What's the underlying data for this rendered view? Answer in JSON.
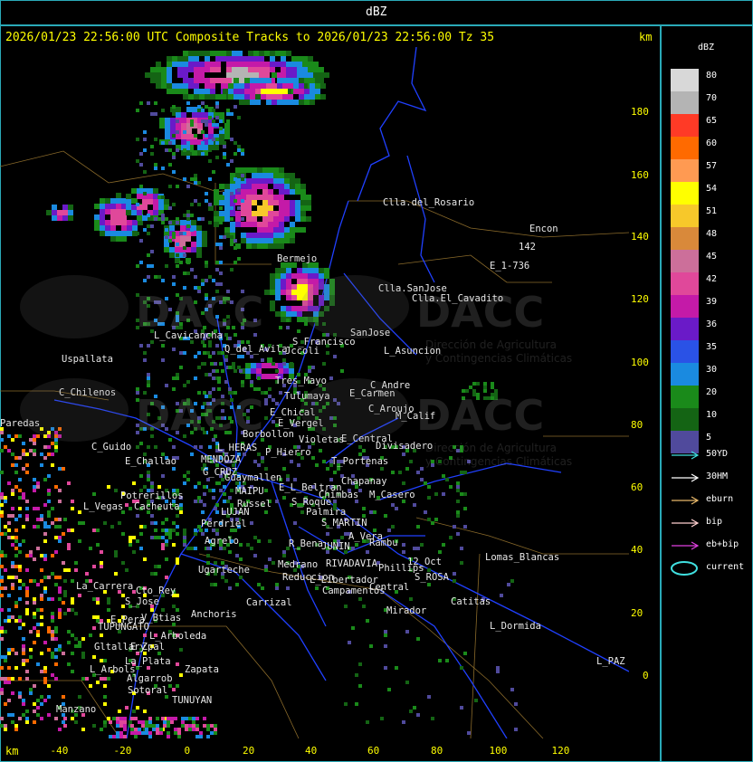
{
  "header": {
    "units": "dBZ"
  },
  "plot": {
    "title": "2026/01/23 22:56:00 UTC Composite Tracks to 2026/01/23 22:56:00 Tz 35",
    "km_top": "km",
    "km_bottom": "km",
    "y_ticks": [
      "180",
      "160",
      "140",
      "120",
      "100",
      "80",
      "60",
      "40",
      "20",
      "0"
    ],
    "x_ticks": [
      "-40",
      "-20",
      "0",
      "20",
      "40",
      "60",
      "80",
      "100",
      "120"
    ]
  },
  "legend": {
    "title": "dBZ",
    "scale": [
      {
        "label": "80",
        "color": "#d8d8d8"
      },
      {
        "label": "70",
        "color": "#b4b4b4"
      },
      {
        "label": "65",
        "color": "#ff3a26"
      },
      {
        "label": "60",
        "color": "#ff6a00"
      },
      {
        "label": "57",
        "color": "#ff9a52"
      },
      {
        "label": "54",
        "color": "#ffff00"
      },
      {
        "label": "51",
        "color": "#f7c82a"
      },
      {
        "label": "48",
        "color": "#d9893a"
      },
      {
        "label": "45",
        "color": "#cc6f9a"
      },
      {
        "label": "42",
        "color": "#e0489a"
      },
      {
        "label": "39",
        "color": "#c41aa8"
      },
      {
        "label": "36",
        "color": "#6a1ac8"
      },
      {
        "label": "35",
        "color": "#2a52e6"
      },
      {
        "label": "30",
        "color": "#1a8ae0"
      },
      {
        "label": "20",
        "color": "#1a8a1a"
      },
      {
        "label": "10",
        "color": "#146414"
      },
      {
        "label": "5",
        "color": "#504a9c"
      }
    ],
    "tracks": [
      {
        "label": "50YD",
        "color": "#40e0e0"
      },
      {
        "label": "30HM",
        "color": "#ffffff"
      },
      {
        "label": "eburn",
        "color": "#e8b86a"
      },
      {
        "label": "bip",
        "color": "#ffd0d0"
      },
      {
        "label": "eb+bip",
        "color": "#e040e0"
      },
      {
        "label": "current",
        "color": "#40e0e0"
      }
    ]
  },
  "places": [
    "Clla.del_Rosario",
    "Encon",
    "142",
    "E_1-736",
    "Clla.SanJose",
    "Clla.El_Cavadito",
    "Bermejo",
    "L_Cavicancha",
    "Q_del_Avila",
    "S_Francisco",
    "SanJose",
    "L_Asuncion",
    "Uspallata",
    "Jccoli",
    "Tres_Mayo",
    "C_Andre",
    "C_Chilenos",
    "Tulumaya",
    "E_Carmen",
    "C_Aroujo",
    "E_Chical",
    "M_Calif",
    "E_Vergel",
    "Borbollon",
    "Violetas",
    "E_Central",
    "Divisadero",
    "P_Hierro",
    "L_HERAS",
    "C_Guido",
    "E_Challao",
    "MENDOZA",
    "T_Portenas",
    "G_CRUZ",
    "Guaymallen",
    "E_L_Beltran",
    "Chapanay",
    "Potrerillos",
    "L_Vegas",
    "Cacheuta",
    "MAIPU",
    "Russel",
    "S_Roque",
    "Chimbas",
    "M_Casero",
    "LUJAN",
    "Palmira",
    "S_MARTIN",
    "Perdriel",
    "A_Vera",
    "Agrelo",
    "R_Bena",
    "JUNIN",
    "Rambu",
    "Ugarteche",
    "Medrano",
    "RIVADAVIA",
    "Phillips",
    "12_Oct",
    "Lomas_Blancas",
    "La_Carrera",
    "Cto_Rey",
    "S_Jose",
    "Reduccion",
    "L_Libertador",
    "S_ROSA",
    "Campamentos",
    "Central",
    "Carrizal",
    "Catitas",
    "Anchoris",
    "V_Btias",
    "E_Pera",
    "TUPUNGATO",
    "Mirador",
    "L_Arboleda",
    "L_Dormida",
    "Gltallary",
    "E_Zpal",
    "La_Plata",
    "L_Arbols",
    "Zapata",
    "L_PAZ",
    "Algarrob",
    "Sotoral",
    "Manzano",
    "TUNUYAN",
    "Paredas"
  ],
  "watermark": {
    "brand": "DACC",
    "line1": "Dirección de Agricultura",
    "line2": "y Contingencias Climáticas"
  }
}
